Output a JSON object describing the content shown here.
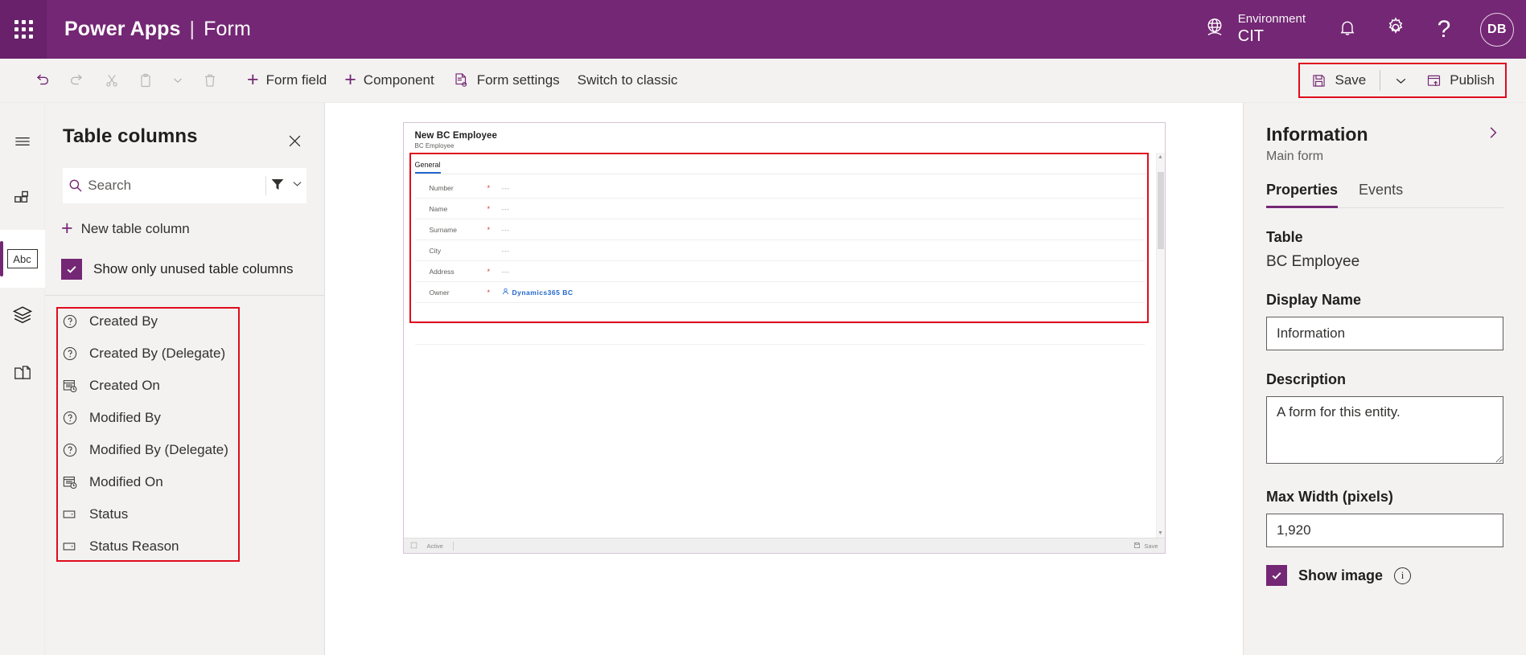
{
  "header": {
    "waffle_icon": "app-launcher-icon",
    "brand_primary": "Power Apps",
    "brand_divider": "|",
    "brand_secondary": "Form",
    "environment_label": "Environment",
    "environment_value": "CIT",
    "globe_icon": "environment-globe-icon",
    "bell_icon": "notifications-bell-icon",
    "gear_icon": "settings-gear-icon",
    "help_icon": "help-question-icon",
    "avatar_initials": "DB",
    "brand_color": "#742774"
  },
  "commandbar": {
    "undo_label": "Undo",
    "redo_label": "Redo",
    "cut_label": "Cut",
    "paste_label": "Paste",
    "paste_caret_label": "More paste options",
    "delete_label": "Delete",
    "form_field_label": "Form field",
    "component_label": "Component",
    "form_settings_label": "Form settings",
    "switch_classic_label": "Switch to classic",
    "save_label": "Save",
    "save_caret_label": "Save options",
    "publish_label": "Publish",
    "highlight_color": "#e00b1c"
  },
  "rail": {
    "items": [
      {
        "icon": "hamburger-menu-icon",
        "name": "menu",
        "active": false
      },
      {
        "icon": "components-grid-icon",
        "name": "components",
        "active": false
      },
      {
        "icon": "table-columns-abc-icon",
        "name": "table-columns",
        "active": true,
        "glyph": "Abc"
      },
      {
        "icon": "layers-tree-icon",
        "name": "tree-view",
        "active": false
      },
      {
        "icon": "related-forms-icon",
        "name": "related-forms",
        "active": false
      }
    ]
  },
  "panel": {
    "title": "Table columns",
    "close_label": "Close",
    "search_placeholder": "Search",
    "search_value": "",
    "filter_label": "Filter",
    "filter_caret_label": "Filter options",
    "new_column_label": "New table column",
    "show_unused_label": "Show only unused table columns",
    "show_unused_checked": true,
    "columns": [
      {
        "label": "Created By",
        "icon": "lookup-question-icon"
      },
      {
        "label": "Created By (Delegate)",
        "icon": "lookup-question-icon"
      },
      {
        "label": "Created On",
        "icon": "date-time-calendar-icon"
      },
      {
        "label": "Modified By",
        "icon": "lookup-question-icon"
      },
      {
        "label": "Modified By (Delegate)",
        "icon": "lookup-question-icon"
      },
      {
        "label": "Modified On",
        "icon": "date-time-calendar-icon"
      },
      {
        "label": "Status",
        "icon": "choice-dropdown-icon"
      },
      {
        "label": "Status Reason",
        "icon": "choice-dropdown-icon"
      }
    ]
  },
  "canvas": {
    "form_title": "New BC Employee",
    "form_subtitle": "BC Employee",
    "tab_label": "General",
    "rows": [
      {
        "label": "Number",
        "required": "*",
        "value": "---",
        "link": false
      },
      {
        "label": "Name",
        "required": "*",
        "value": "---",
        "link": false
      },
      {
        "label": "Surname",
        "required": "*",
        "value": "---",
        "link": false
      },
      {
        "label": "City",
        "required": "",
        "value": "---",
        "link": false
      },
      {
        "label": "Address",
        "required": "*",
        "value": "---",
        "link": false
      },
      {
        "label": "Owner",
        "required": "*",
        "value": "Dynamics365 BC",
        "link": true
      }
    ],
    "footer_status": "Active",
    "footer_save": "Save",
    "footer_icon": "maximize-icon",
    "footer_save_icon": "save-disk-icon"
  },
  "properties": {
    "title": "Information",
    "subtitle": "Main form",
    "expand_label": "Expand",
    "tabs": [
      {
        "label": "Properties",
        "active": true
      },
      {
        "label": "Events",
        "active": false
      }
    ],
    "table_label": "Table",
    "table_value": "BC Employee",
    "display_name_label": "Display Name",
    "display_name_value": "Information",
    "description_label": "Description",
    "description_value": "A form for this entity.",
    "max_width_label": "Max Width (pixels)",
    "max_width_value": "1,920",
    "show_image_label": "Show image",
    "show_image_checked": true,
    "show_image_info_label": "More information"
  }
}
